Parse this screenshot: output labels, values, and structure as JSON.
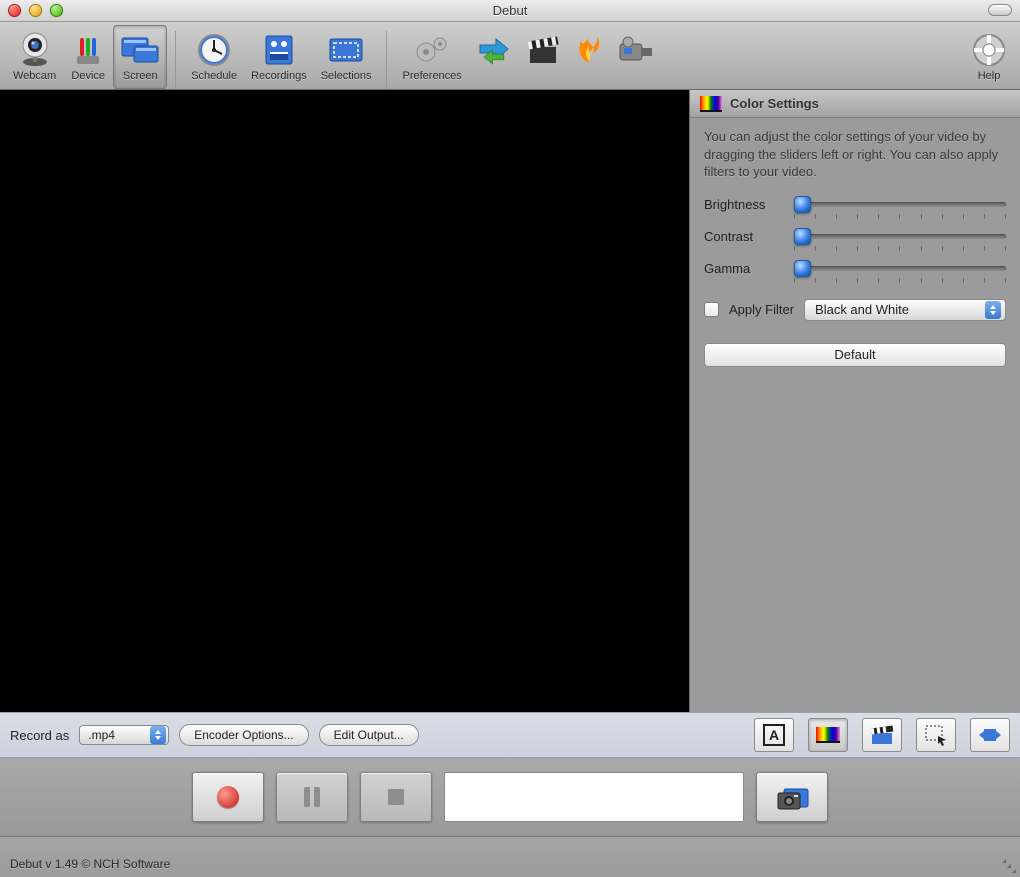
{
  "window": {
    "title": "Debut"
  },
  "toolbar": {
    "items": [
      {
        "label": "Webcam"
      },
      {
        "label": "Device"
      },
      {
        "label": "Screen"
      },
      {
        "label": "Schedule"
      },
      {
        "label": "Recordings"
      },
      {
        "label": "Selections"
      },
      {
        "label": "Preferences"
      }
    ],
    "help_label": "Help"
  },
  "color_panel": {
    "title": "Color Settings",
    "description": "You can adjust the color settings of your video by dragging the sliders left or right. You can also apply filters to your video.",
    "brightness_label": "Brightness",
    "contrast_label": "Contrast",
    "gamma_label": "Gamma",
    "apply_filter_label": "Apply Filter",
    "filter_selected": "Black and White",
    "default_label": "Default"
  },
  "recordbar": {
    "record_as_label": "Record as",
    "format_selected": ".mp4",
    "encoder_options_label": "Encoder Options...",
    "edit_output_label": "Edit Output..."
  },
  "footer": {
    "text": "Debut v 1.49 © NCH Software"
  }
}
